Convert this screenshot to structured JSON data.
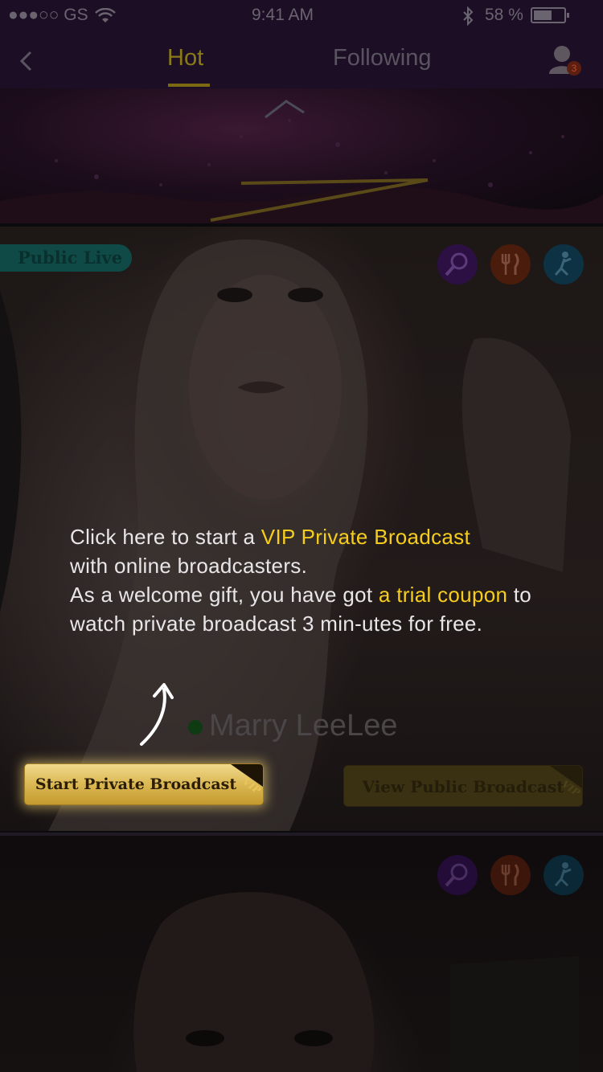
{
  "status_bar": {
    "carrier": "●●●○○ GS",
    "time": "9:41 AM",
    "battery": "58 %"
  },
  "nav": {
    "tabs": [
      {
        "label": "Hot",
        "active": true
      },
      {
        "label": "Following",
        "active": false
      }
    ],
    "notification_count": "3"
  },
  "cards": [
    {
      "badge": "Public Live",
      "name": "Marry LeeLee",
      "online": true,
      "public_button": "View Public Broadcast",
      "vip_tag": "VIP",
      "categories": [
        "singing-icon",
        "food-icon",
        "dance-icon"
      ]
    },
    {
      "categories": [
        "singing-icon",
        "food-icon",
        "dance-icon"
      ]
    }
  ],
  "guide": {
    "line1_pre": "Click here to start a ",
    "line1_hl": "VIP Private Broadcast",
    "line2": "with online broadcasters.",
    "line3_pre": "As a welcome gift, you have got ",
    "line3_hl": "a trial coupon",
    "line3_post": " to watch private broadcast 3 min-utes for free.",
    "button": "Start Private Broadcast",
    "vip_tag": "VIP"
  },
  "colors": {
    "accent_gold": "#f6cd1d",
    "button_gold": "#ddbb58",
    "nav_bg": "#1c0f25"
  }
}
